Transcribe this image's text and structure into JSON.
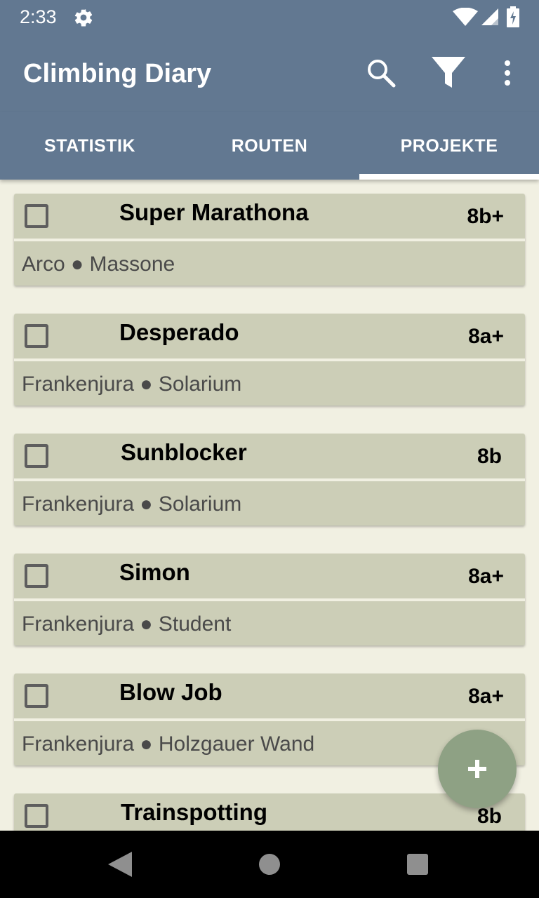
{
  "status_bar": {
    "time": "2:33",
    "icons": [
      "gear-icon",
      "wifi-icon",
      "cell-signal-icon",
      "battery-charging-icon"
    ]
  },
  "app_bar": {
    "title": "Climbing Diary",
    "actions": [
      "search-icon",
      "filter-icon",
      "more-vert-icon"
    ]
  },
  "tabs": [
    {
      "label": "STATISTIK",
      "selected": false
    },
    {
      "label": "ROUTEN",
      "selected": false
    },
    {
      "label": "PROJEKTE",
      "selected": true
    }
  ],
  "routes": [
    {
      "name": "Super Marathona",
      "grade": "8b+",
      "location": "Arco ● Massone",
      "checked": false
    },
    {
      "name": "Desperado",
      "grade": "8a+",
      "location": "Frankenjura ● Solarium",
      "checked": false
    },
    {
      "name": "Sunblocker",
      "grade": "8b",
      "location": "Frankenjura ● Solarium",
      "checked": false
    },
    {
      "name": "Simon",
      "grade": "8a+",
      "location": "Frankenjura ● Student",
      "checked": false
    },
    {
      "name": "Blow Job",
      "grade": "8a+",
      "location": "Frankenjura ● Holzgauer Wand",
      "checked": false
    },
    {
      "name": "Trainspotting",
      "grade": "8b",
      "location": "",
      "checked": false
    }
  ],
  "fab": {
    "icon": "plus-icon"
  },
  "nav_bar": {
    "icons": [
      "back-icon",
      "home-icon",
      "recents-icon"
    ]
  },
  "colors": {
    "primary": "#627891",
    "background": "#F1F0E2",
    "card": "#CCCEB7",
    "fab": "#8EA184"
  }
}
